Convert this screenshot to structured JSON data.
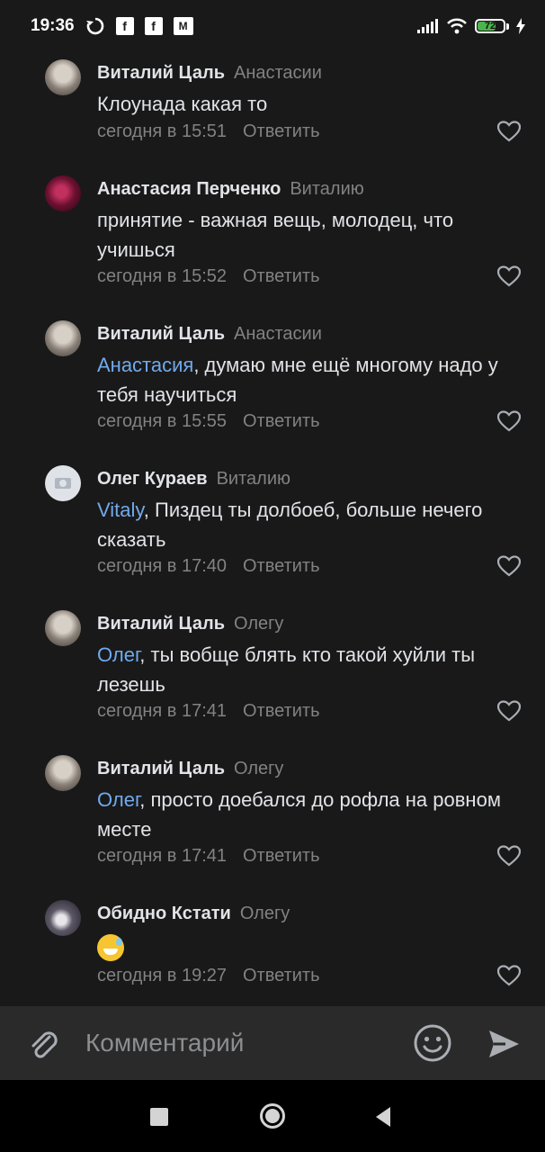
{
  "status_bar": {
    "time": "19:36",
    "icons": [
      "sync-icon",
      "facebook-icon",
      "facebook-icon",
      "ml-icon"
    ],
    "battery": "72",
    "battery_level": 0.72
  },
  "comments": [
    {
      "author": "Виталий Цаль",
      "reply_to": "Анастасии",
      "mention": "",
      "text": "Клоунада какая то",
      "time": "сегодня в 15:51",
      "reply_label": "Ответить",
      "avatar": "vit"
    },
    {
      "author": "Анастасия Перченко",
      "reply_to": "Виталию",
      "mention": "",
      "text": "принятие - важная вещь, молодец, что учишься",
      "time": "сегодня в 15:52",
      "reply_label": "Ответить",
      "avatar": "ana"
    },
    {
      "author": "Виталий Цаль",
      "reply_to": "Анастасии",
      "mention": "Анастасия",
      "text": ", думаю мне ещё многому надо у тебя научиться",
      "time": "сегодня в 15:55",
      "reply_label": "Ответить",
      "avatar": "vit"
    },
    {
      "author": "Олег Кураев",
      "reply_to": "Виталию",
      "mention": "Vitaly",
      "text": ", Пиздец ты долбоеб, больше нечего сказать",
      "time": "сегодня в 17:40",
      "reply_label": "Ответить",
      "avatar": "oleg"
    },
    {
      "author": "Виталий Цаль",
      "reply_to": "Олегу",
      "mention": "Олег",
      "text": ", ты вобще блять кто такой хуйли ты лезешь",
      "time": "сегодня в 17:41",
      "reply_label": "Ответить",
      "avatar": "vit"
    },
    {
      "author": "Виталий Цаль",
      "reply_to": "Олегу",
      "mention": "Олег",
      "text": ", просто доебался до рофла на ровном месте",
      "time": "сегодня в 17:41",
      "reply_label": "Ответить",
      "avatar": "vit"
    },
    {
      "author": "Обидно Кстати",
      "reply_to": "Олегу",
      "mention": "",
      "text": "",
      "emoji": "sweat-smile-emoji",
      "time": "сегодня в 19:27",
      "reply_label": "Ответить",
      "avatar": "obid"
    }
  ],
  "composer": {
    "placeholder": "Комментарий"
  }
}
